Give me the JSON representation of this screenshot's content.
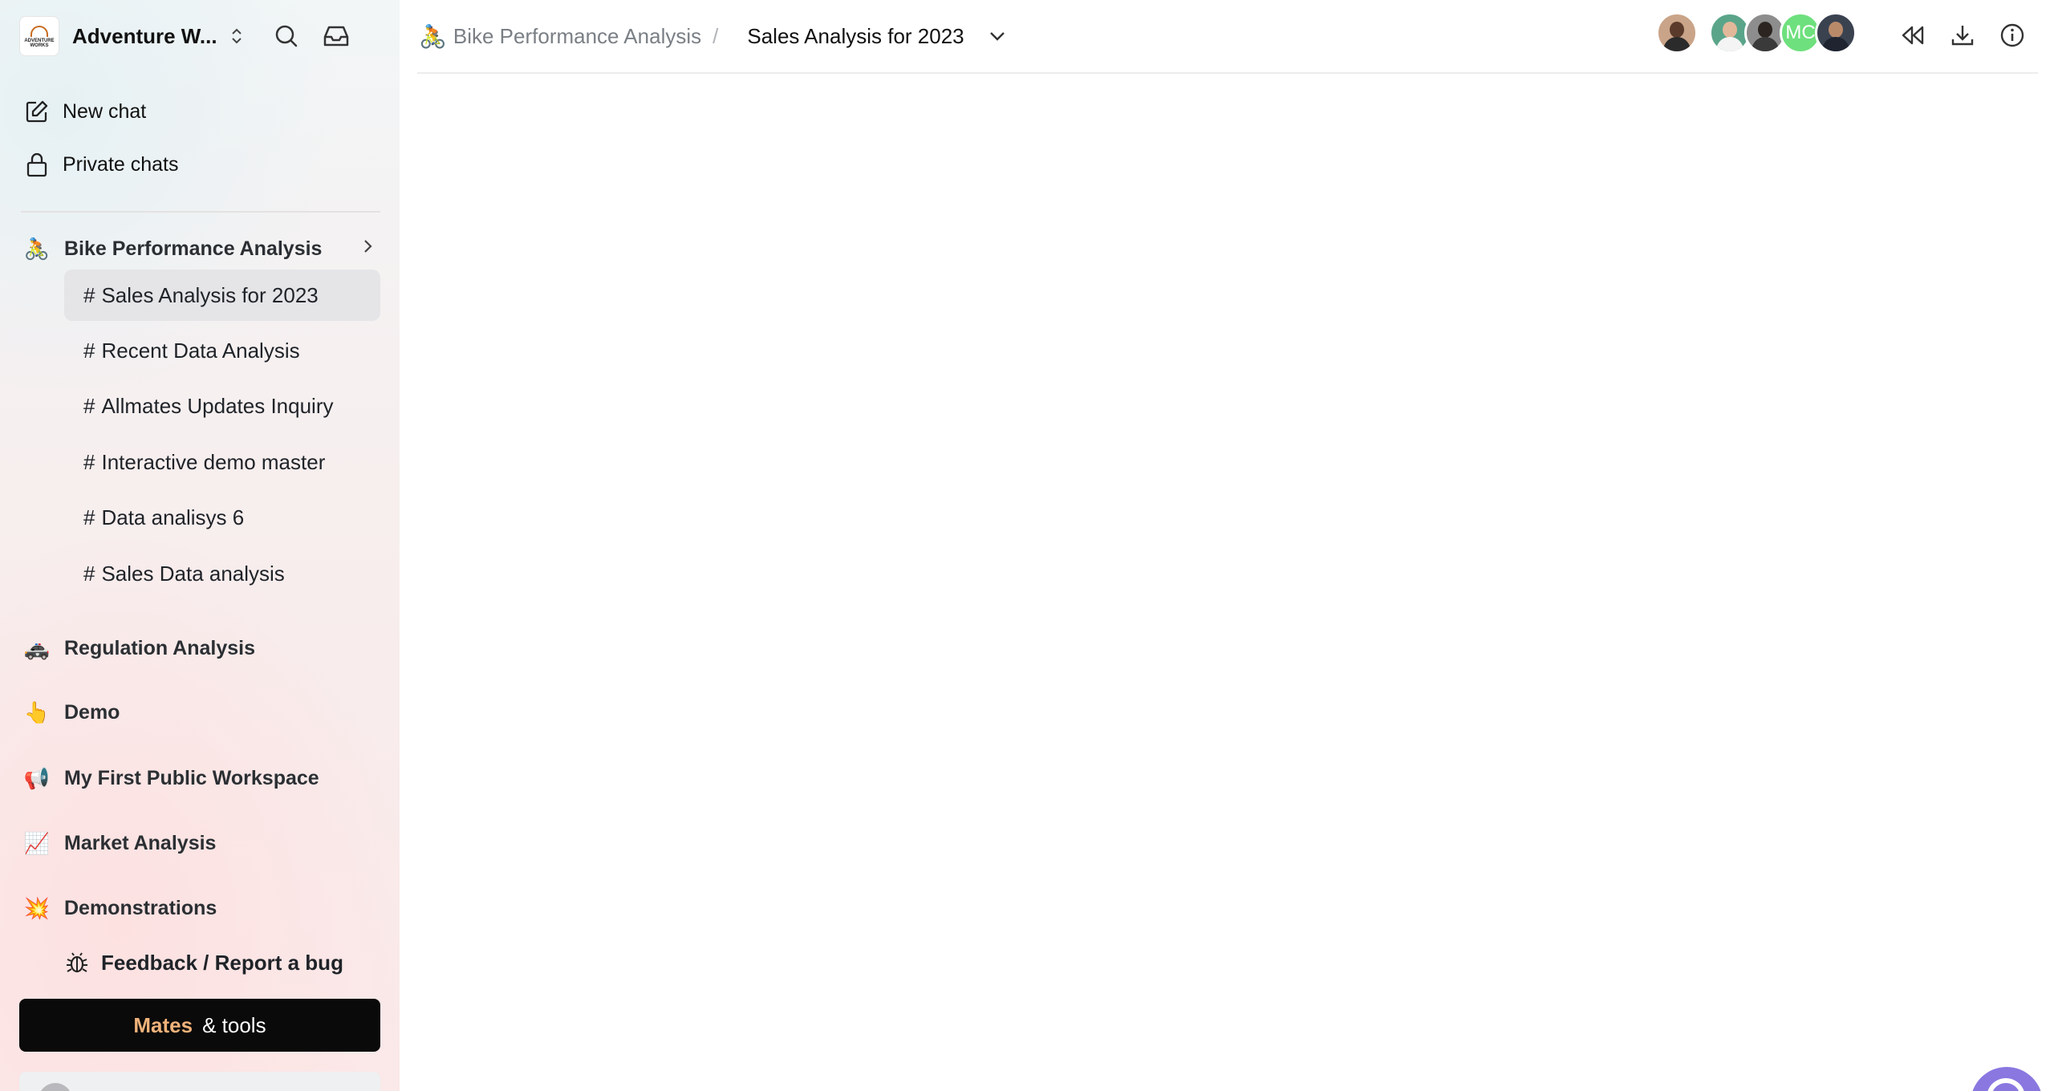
{
  "workspace": {
    "name": "Adventure W...",
    "logo_text": "ADVENTURE WORKS"
  },
  "nav": {
    "new_chat": "New chat",
    "private_chats": "Private chats"
  },
  "sections": [
    {
      "emoji": "🚴",
      "label": "Bike Performance Analysis"
    },
    {
      "emoji": "🚓",
      "label": "Regulation Analysis"
    },
    {
      "emoji": "👆",
      "label": "Demo"
    },
    {
      "emoji": "📢",
      "label": "My First Public Workspace"
    },
    {
      "emoji": "📈",
      "label": "Market Analysis"
    },
    {
      "emoji": "💥",
      "label": "Demonstrations"
    }
  ],
  "channels": [
    {
      "hash": "#",
      "label": "Sales Analysis for 2023",
      "active": true
    },
    {
      "hash": "#",
      "label": "Recent Data Analysis"
    },
    {
      "hash": "#",
      "label": "Allmates Updates Inquiry"
    },
    {
      "hash": "#",
      "label": "Interactive demo master"
    },
    {
      "hash": "#",
      "label": "Data analisys 6"
    },
    {
      "hash": "#",
      "label": "Sales Data analysis"
    }
  ],
  "feedback": "Feedback / Report a bug",
  "mates_button": {
    "brand": "Mates",
    "rest": "& tools"
  },
  "breadcrumb": {
    "emoji": "🚴",
    "parent": "Bike Performance Analysis",
    "separator": "/",
    "current": "Sales Analysis for 2023"
  },
  "avatars": {
    "initials_mc": "MC"
  },
  "colors": {
    "accent_purple": "#8a77e0",
    "mates_brand": "#f0b27a",
    "active_channel_bg": "#e5e5e8"
  }
}
